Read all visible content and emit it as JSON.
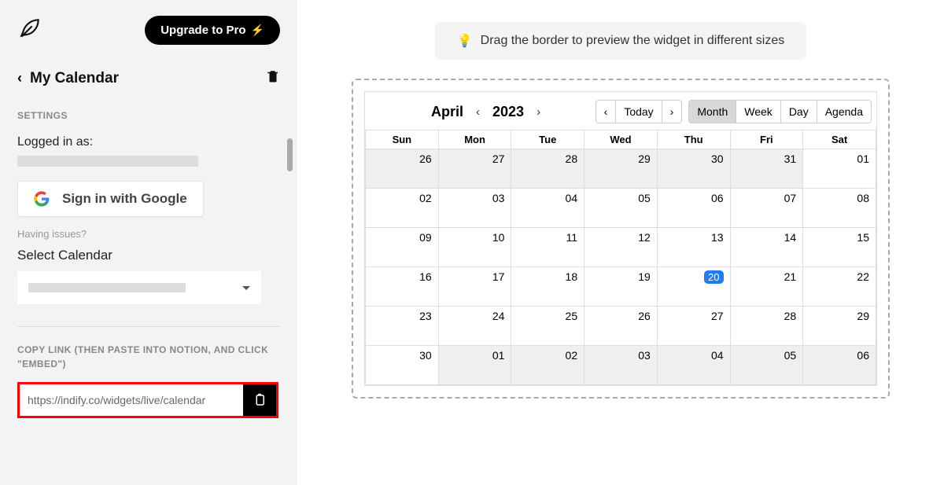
{
  "header": {
    "upgrade_label": "Upgrade to Pro"
  },
  "page": {
    "title": "My Calendar"
  },
  "settings": {
    "section_label": "SETTINGS",
    "logged_in_label": "Logged in as:",
    "google_signin_label": "Sign in with Google",
    "issues_text": "Having issues?",
    "select_calendar_label": "Select Calendar"
  },
  "embed": {
    "copy_label": "COPY LINK (THEN PASTE INTO NOTION, AND CLICK \"EMBED\")",
    "link_value": "https://indify.co/widgets/live/calendar"
  },
  "hint": {
    "text": "Drag the border to preview the widget in different sizes",
    "icon": "💡"
  },
  "calendar": {
    "month": "April",
    "year": "2023",
    "today_label": "Today",
    "views": [
      "Month",
      "Week",
      "Day",
      "Agenda"
    ],
    "active_view": "Month",
    "day_headers": [
      "Sun",
      "Mon",
      "Tue",
      "Wed",
      "Thu",
      "Fri",
      "Sat"
    ],
    "today_date": 20,
    "weeks": [
      [
        {
          "d": 26,
          "off": true
        },
        {
          "d": 27,
          "off": true
        },
        {
          "d": 28,
          "off": true
        },
        {
          "d": 29,
          "off": true
        },
        {
          "d": 30,
          "off": true
        },
        {
          "d": 31,
          "off": true
        },
        {
          "d": "01"
        }
      ],
      [
        {
          "d": "02"
        },
        {
          "d": "03"
        },
        {
          "d": "04"
        },
        {
          "d": "05"
        },
        {
          "d": "06"
        },
        {
          "d": "07"
        },
        {
          "d": "08"
        }
      ],
      [
        {
          "d": "09"
        },
        {
          "d": 10
        },
        {
          "d": 11
        },
        {
          "d": 12
        },
        {
          "d": 13
        },
        {
          "d": 14
        },
        {
          "d": 15
        }
      ],
      [
        {
          "d": 16
        },
        {
          "d": 17
        },
        {
          "d": 18
        },
        {
          "d": 19
        },
        {
          "d": 20,
          "today": true
        },
        {
          "d": 21
        },
        {
          "d": 22
        }
      ],
      [
        {
          "d": 23
        },
        {
          "d": 24
        },
        {
          "d": 25
        },
        {
          "d": 26
        },
        {
          "d": 27
        },
        {
          "d": 28
        },
        {
          "d": 29
        }
      ],
      [
        {
          "d": 30
        },
        {
          "d": "01",
          "off": true
        },
        {
          "d": "02",
          "off": true
        },
        {
          "d": "03",
          "off": true
        },
        {
          "d": "04",
          "off": true
        },
        {
          "d": "05",
          "off": true
        },
        {
          "d": "06",
          "off": true
        }
      ]
    ]
  }
}
